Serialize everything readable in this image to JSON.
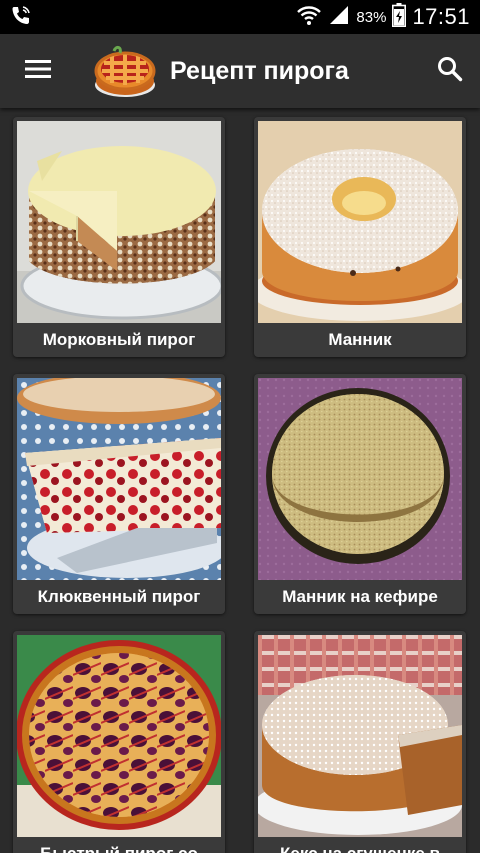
{
  "status_bar": {
    "battery_percent": "83%",
    "time": "17:51",
    "icons": [
      "phone-icon",
      "wifi-icon",
      "signal-icon",
      "battery-icon"
    ]
  },
  "app_bar": {
    "title": "Рецепт пирога",
    "icons": [
      "menu-icon",
      "pie-logo-icon",
      "search-icon"
    ]
  },
  "recipes": [
    {
      "label": "Морковный пирог"
    },
    {
      "label": "Манник"
    },
    {
      "label": "Клюквенный пирог"
    },
    {
      "label": "Манник на кефире"
    },
    {
      "label": "Быстрый пирог со"
    },
    {
      "label": "Кекс на сгущенке в"
    }
  ]
}
